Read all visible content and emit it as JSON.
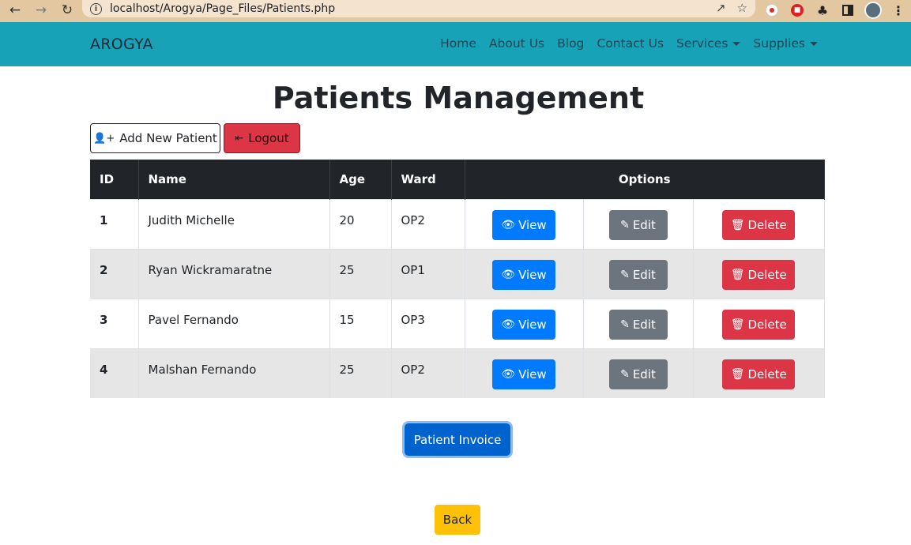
{
  "browser": {
    "url": "localhost/Arogya/Page_Files/Patients.php"
  },
  "navbar": {
    "brand": "AROGYA",
    "links": [
      {
        "label": "Home"
      },
      {
        "label": "About Us"
      },
      {
        "label": "Blog"
      },
      {
        "label": "Contact Us"
      },
      {
        "label": "Services",
        "dropdown": true
      },
      {
        "label": "Supplies",
        "dropdown": true
      }
    ],
    "background_color": "#17a2b8"
  },
  "page": {
    "title": "Patients Management",
    "add_button_label": "Add New Patient",
    "logout_button_label": "Logout"
  },
  "table": {
    "headers": {
      "id": "ID",
      "name": "Name",
      "age": "Age",
      "ward": "Ward",
      "options": "Options"
    },
    "rows": [
      {
        "id": "1",
        "name": "Judith Michelle",
        "age": "20",
        "ward": "OP2"
      },
      {
        "id": "2",
        "name": "Ryan Wickramaratne",
        "age": "25",
        "ward": "OP1"
      },
      {
        "id": "3",
        "name": "Pavel Fernando",
        "age": "15",
        "ward": "OP3"
      },
      {
        "id": "4",
        "name": "Malshan Fernando",
        "age": "25",
        "ward": "OP2"
      }
    ],
    "actions": {
      "view": "View",
      "edit": "Edit",
      "delete": "Delete"
    }
  },
  "footer": {
    "invoice_label": "Patient Invoice",
    "back_label": "Back"
  },
  "colors": {
    "primary": "#007bff",
    "secondary": "#6c757d",
    "danger": "#dc3545",
    "warning": "#ffc107",
    "dark": "#212529"
  }
}
